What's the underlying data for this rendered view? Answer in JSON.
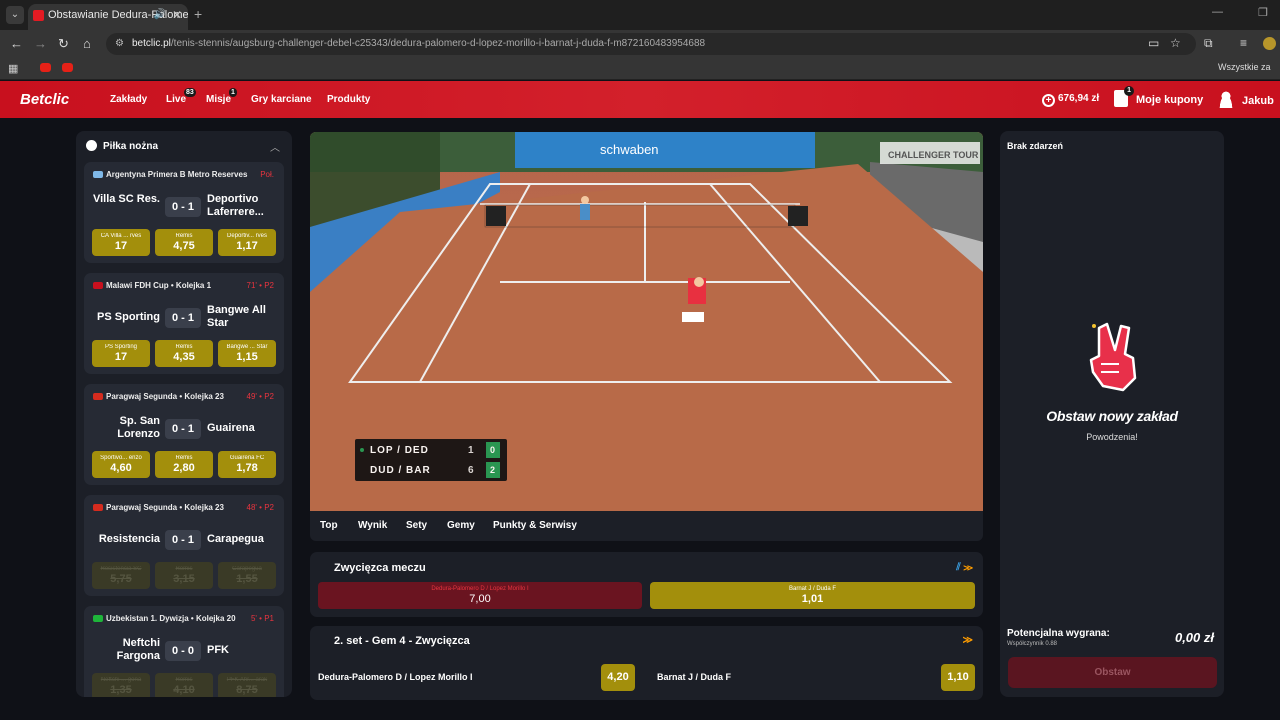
{
  "browser": {
    "tab_title": "Obstawianie Dedura-Palomero",
    "url_host": "betclic.pl",
    "url_path": "/tenis-stennis/augsburg-challenger-debel-c25343/dedura-palomero-d-lopez-morillo-i-barnat-j-duda-f-m872160483954688",
    "bookmarks_all": "Wszystkie za"
  },
  "header": {
    "logo": "Betclic",
    "nav": [
      {
        "label": "Zakłady",
        "badge": ""
      },
      {
        "label": "Live",
        "badge": "83"
      },
      {
        "label": "Misje",
        "badge": "1"
      },
      {
        "label": "Gry karciane",
        "badge": ""
      },
      {
        "label": "Produkty",
        "badge": ""
      }
    ],
    "balance": "676,94 zł",
    "coupons_label": "Moje kupony",
    "coupons_badge": "1",
    "user_name": "Jakub"
  },
  "sidebar": {
    "title": "Piłka nożna",
    "matches": [
      {
        "league": "Argentyna Primera B Metro Reserves",
        "time": "Poł.",
        "home": "Villa SC Res.",
        "score": "0 - 1",
        "away": "Deportivo Laferrere...",
        "flag": "#7fb8e8",
        "odds": [
          {
            "label": "CA Villa ... rves",
            "value": "17"
          },
          {
            "label": "Remis",
            "value": "4,75"
          },
          {
            "label": "Deportiv... rves",
            "value": "1,17"
          }
        ],
        "locked": false
      },
      {
        "league": "Malawi FDH Cup • Kolejka 1",
        "time": "71' • P2",
        "home": "PS Sporting",
        "score": "0 - 1",
        "away": "Bangwe All Star",
        "flag": "#c8101e",
        "odds": [
          {
            "label": "PS Sporting",
            "value": "17"
          },
          {
            "label": "Remis",
            "value": "4,35"
          },
          {
            "label": "Bangwe ... Star",
            "value": "1,15"
          }
        ],
        "locked": false
      },
      {
        "league": "Paragwaj Segunda • Kolejka 23",
        "time": "49' • P2",
        "home": "Sp. San Lorenzo",
        "score": "0 - 1",
        "away": "Guairena",
        "flag": "#d52b1e",
        "odds": [
          {
            "label": "Sportivo... enzo",
            "value": "4,60"
          },
          {
            "label": "Remis",
            "value": "2,80"
          },
          {
            "label": "Guairena FC",
            "value": "1,78"
          }
        ],
        "locked": false
      },
      {
        "league": "Paragwaj Segunda • Kolejka 23",
        "time": "48' • P2",
        "home": "Resistencia",
        "score": "0 - 1",
        "away": "Carapegua",
        "flag": "#d52b1e",
        "odds": [
          {
            "label": "Resistencia SC",
            "value": "5,75"
          },
          {
            "label": "Remis",
            "value": "3,15"
          },
          {
            "label": "Carapegua",
            "value": "1,55"
          }
        ],
        "locked": true
      },
      {
        "league": "Uzbekistan 1. Dywizja • Kolejka 20",
        "time": "5' • P1",
        "home": "Neftchi Fargona",
        "score": "0 - 0",
        "away": "PFK",
        "flag": "#1eb53a",
        "odds": [
          {
            "label": "Neftchi ... gona",
            "value": "1,35"
          },
          {
            "label": "Remis",
            "value": "4,10"
          },
          {
            "label": "PFK Ahr... arak",
            "value": "8,75"
          }
        ],
        "locked": true
      }
    ]
  },
  "video": {
    "scoreboard": [
      {
        "team": "LOP / DED",
        "games": "1",
        "set": "0",
        "serving": true
      },
      {
        "team": "DUD / BAR",
        "games": "6",
        "set": "2",
        "serving": false
      }
    ],
    "banner": "schwaben",
    "banner2": "CHALLENGER TOUR"
  },
  "match_tabs": [
    "Top",
    "Wynik",
    "Sety",
    "Gemy",
    "Punkty & Serwisy"
  ],
  "markets": {
    "winner": {
      "title": "Zwycięzca meczu",
      "sel1": {
        "label": "Dedura-Palomero D / Lopez Morillo I",
        "value": "7,00"
      },
      "sel2": {
        "label": "Barnat J / Duda F",
        "value": "1,01"
      }
    },
    "game": {
      "title": "2. set - Gem 4 - Zwycięzca",
      "sel1": {
        "label": "Dedura-Palomero D / Lopez Morillo I",
        "value": "4,20"
      },
      "sel2": {
        "label": "Barnat J / Duda F",
        "value": "1,10"
      }
    }
  },
  "betslip": {
    "title": "Brak zdarzeń",
    "cta": "Obstaw nowy zakład",
    "sub": "Powodzenia!",
    "potential_label": "Potencjalna wygrana:",
    "coef_label": "Współczynnik 0.88",
    "amount": "0,00 zł",
    "button": "Obstaw"
  },
  "colors": {
    "brand": "#c8101e",
    "odds_gold": "#a38f0c",
    "panel": "#1c1f27"
  }
}
